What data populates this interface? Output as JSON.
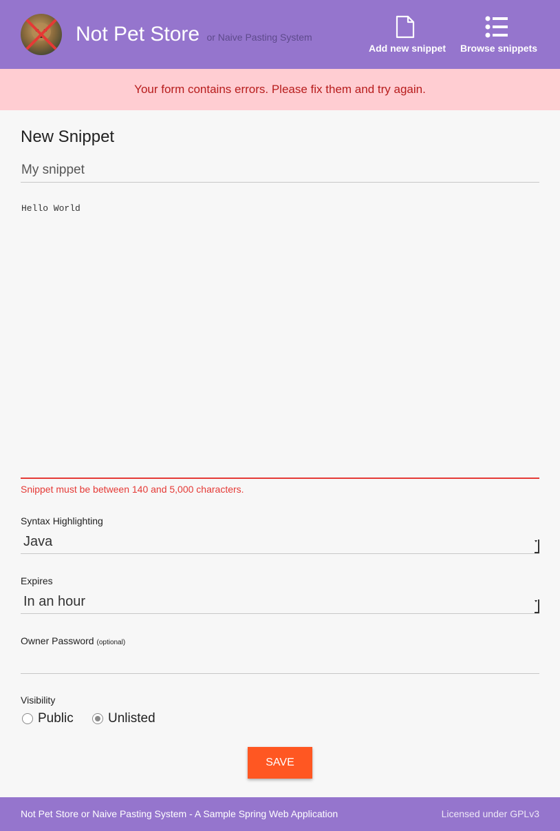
{
  "header": {
    "brand": "Not Pet Store",
    "brand_sub": "or Naive Pasting System",
    "nav": {
      "add_label": "Add new snippet",
      "browse_label": "Browse snippets"
    }
  },
  "banner": {
    "message": "Your form contains errors. Please fix them and try again."
  },
  "form": {
    "title": "New Snippet",
    "name_value": "My snippet",
    "code_value": "Hello World",
    "code_error": "Snippet must be between 140 and 5,000 characters.",
    "syntax": {
      "label": "Syntax Highlighting",
      "selected": "Java"
    },
    "expires": {
      "label": "Expires",
      "selected": "In an hour"
    },
    "password": {
      "label": "Owner Password",
      "hint": "(optional)",
      "value": ""
    },
    "visibility": {
      "label": "Visibility",
      "options": [
        {
          "label": "Public",
          "checked": false
        },
        {
          "label": "Unlisted",
          "checked": true
        }
      ]
    },
    "save_label": "SAVE"
  },
  "footer": {
    "left": "Not Pet Store or Naive Pasting System - A Sample Spring Web Application",
    "right": "Licensed under GPLv3"
  },
  "colors": {
    "header_bg": "#9575cd",
    "banner_bg": "#ffcdd2",
    "banner_text": "#b71c1c",
    "error": "#e53935",
    "accent": "#ff5722"
  }
}
